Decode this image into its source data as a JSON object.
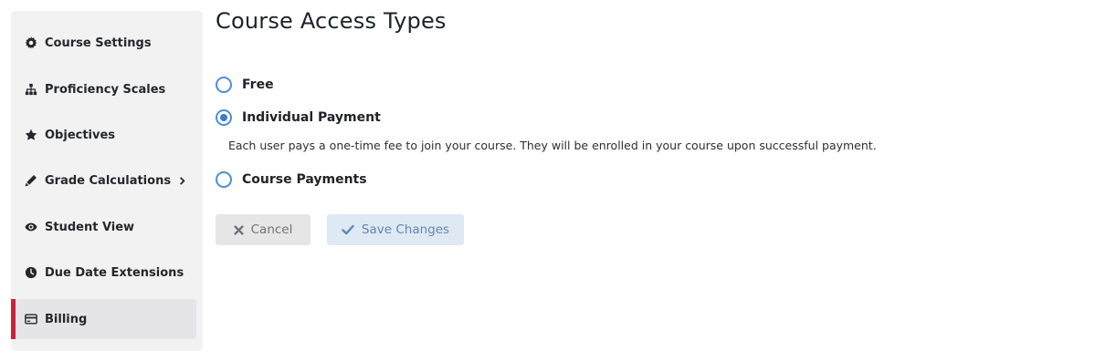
{
  "sidebar": {
    "items": [
      {
        "label": "Course Settings",
        "icon": "gear-icon"
      },
      {
        "label": "Proficiency Scales",
        "icon": "sitemap-icon"
      },
      {
        "label": "Objectives",
        "icon": "star-icon"
      },
      {
        "label": "Grade Calculations",
        "icon": "pencil-icon",
        "has_submenu": true
      },
      {
        "label": "Student View",
        "icon": "eye-icon"
      },
      {
        "label": "Due Date Extensions",
        "icon": "clock-icon"
      },
      {
        "label": "Billing",
        "icon": "credit-card-icon",
        "active": true
      }
    ],
    "active_accent": "#c8223c"
  },
  "main": {
    "title": "Course Access Types",
    "options": [
      {
        "label": "Free",
        "selected": false
      },
      {
        "label": "Individual Payment",
        "selected": true
      },
      {
        "label": "Course Payments",
        "selected": false
      }
    ],
    "selected_description": "Each user pays a one-time fee to join your course. They will be enrolled in your course upon successful payment.",
    "buttons": {
      "cancel_label": "Cancel",
      "save_label": "Save Changes"
    }
  },
  "colors": {
    "radio_accent": "#3a7bd5",
    "save_button_bg": "#dfe9f3",
    "cancel_button_bg": "#e6e6e7"
  }
}
